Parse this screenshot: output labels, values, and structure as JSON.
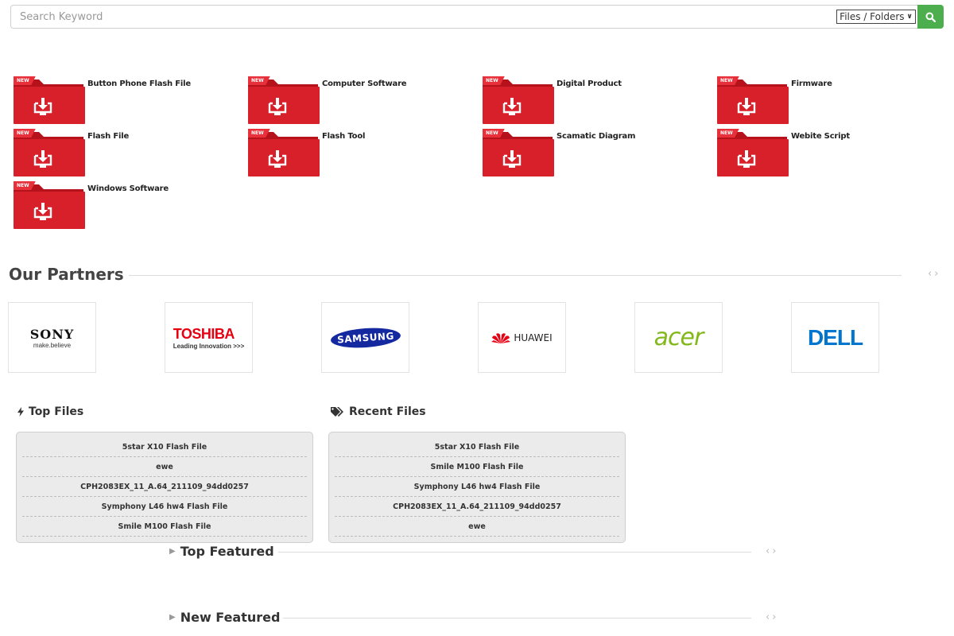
{
  "search": {
    "placeholder": "Search Keyword",
    "scope_value": "Files / Folders",
    "button_icon": "search-icon"
  },
  "categories": [
    {
      "label": "Button Phone Flash File",
      "badge": "NEW"
    },
    {
      "label": "Computer Software",
      "badge": "NEW"
    },
    {
      "label": "Digital Product",
      "badge": "NEW"
    },
    {
      "label": "Firmware",
      "badge": "NEW"
    },
    {
      "label": "Flash File",
      "badge": "NEW"
    },
    {
      "label": "Flash Tool",
      "badge": "NEW"
    },
    {
      "label": "Scamatic Diagram",
      "badge": "NEW"
    },
    {
      "label": "Webite Script",
      "badge": "NEW"
    },
    {
      "label": "Windows Software",
      "badge": "NEW"
    }
  ],
  "partners": {
    "title": "Our Partners",
    "logos": [
      {
        "name": "SONY",
        "tagline": "make.believe",
        "color": "#111111"
      },
      {
        "name": "TOSHIBA",
        "tagline": "Leading Innovation >>>",
        "color": "#e60012"
      },
      {
        "name": "SAMSUNG",
        "tagline": "",
        "color": "#1428a0"
      },
      {
        "name": "HUAWEI",
        "tagline": "",
        "color": "#e60012"
      },
      {
        "name": "acer",
        "tagline": "",
        "color": "#83b81a"
      },
      {
        "name": "DELL",
        "tagline": "",
        "color": "#0076ce"
      }
    ]
  },
  "top_files": {
    "title": "Top Files",
    "items": [
      "5star X10 Flash File",
      "ewe",
      "CPH2083EX_11_A.64_211109_94dd0257",
      "Symphony L46 hw4 Flash File",
      "Smile M100 Flash File"
    ]
  },
  "recent_files": {
    "title": "Recent Files",
    "items": [
      "5star X10 Flash File",
      "Smile M100 Flash File",
      "Symphony L46 hw4 Flash File",
      "CPH2083EX_11_A.64_211109_94dd0257",
      "ewe"
    ]
  },
  "top_featured": {
    "title": "Top Featured"
  },
  "new_featured": {
    "title": "New Featured"
  },
  "colors": {
    "accent_green": "#4cae4c",
    "folder_red": "#d8202a",
    "badge_red": "#e8303a"
  }
}
